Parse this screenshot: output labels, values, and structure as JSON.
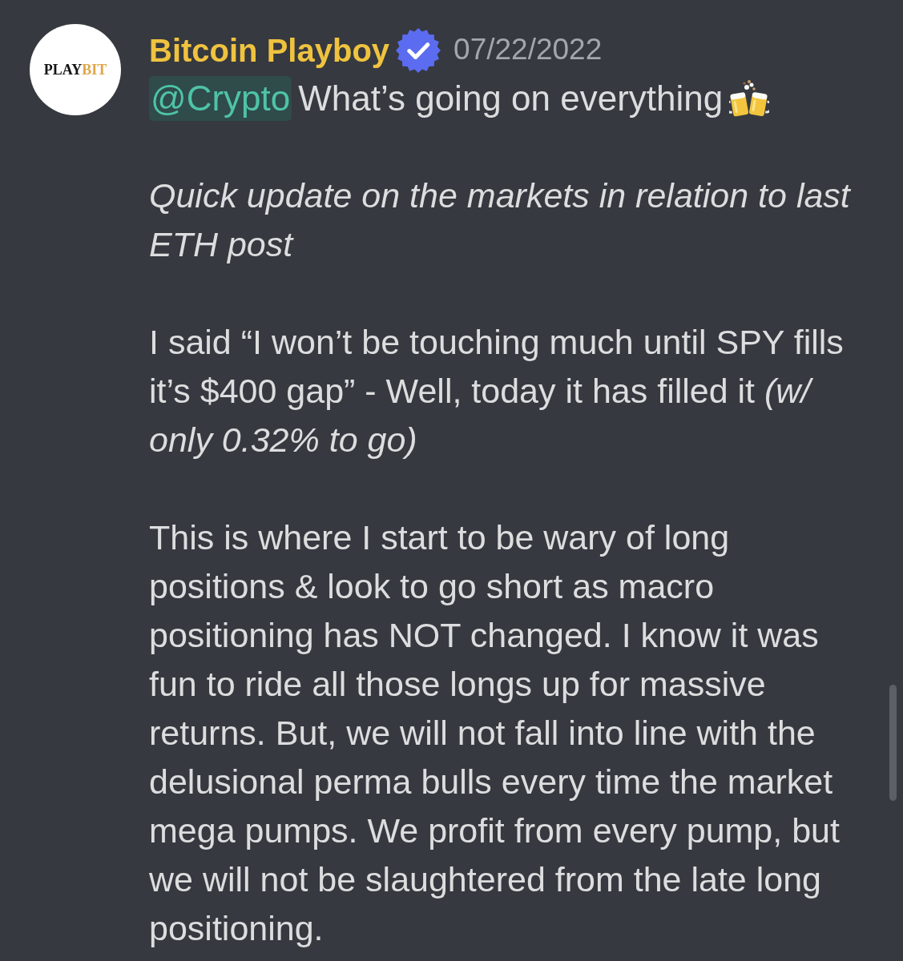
{
  "author": {
    "avatar": {
      "logo": [
        {
          "text": "PLAY",
          "color": "#141414"
        },
        {
          "text": "BIT",
          "color": "#e0a548"
        }
      ]
    },
    "name": "Bitcoin Playboy",
    "verified": true,
    "date": "07/22/2022"
  },
  "message": {
    "first_line": {
      "mention": "@Crypto",
      "text": "What’s going on everything"
    },
    "paragraphs": [
      {
        "kind": "italic",
        "text": "Quick update on the markets in relation to last ETH post"
      },
      {
        "kind": "plain",
        "text": "I said “I won’t be touching much until SPY fills it’s $400 gap” - Well, today it has filled it *(w/ only 0.32% to go)*"
      },
      {
        "kind": "plain",
        "text": "This is where I start to be wary of long positions & look to go short as macro positioning has NOT changed. I know it was fun to ride all those longs up for massive returns. But, we will not fall into line with the delusional perma bulls every time the market mega pumps. We profit from every pump, but we will not be slaughtered from the late long positioning."
      }
    ]
  }
}
